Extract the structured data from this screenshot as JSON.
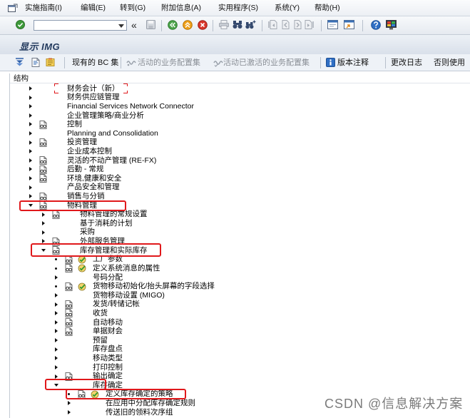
{
  "window": {
    "title": "显示 IMG"
  },
  "menu_bar": {
    "items": [
      "实施指南(I)",
      "编辑(E)",
      "转到(G)",
      "附加信息(A)",
      "实用程序(S)",
      "系统(Y)",
      "帮助(H)"
    ]
  },
  "toolbar": {
    "command_field": {
      "value": "",
      "placeholder": ""
    },
    "collapse_glyph": "«",
    "icons": [
      "enter-icon",
      "save-icon",
      "back-icon",
      "exit-icon",
      "cancel-icon",
      "print-icon",
      "find-icon",
      "find-next-icon",
      "first-page-icon",
      "previous-page-icon",
      "next-page-icon",
      "last-page-icon",
      "create-session-icon",
      "create-shortcut-icon",
      "help-icon",
      "customize-layout-icon"
    ]
  },
  "app_toolbar": {
    "icons": [
      "expand-subtree-icon",
      "documentation-icon",
      "notes-icon",
      "bc-set-icon",
      "bc-set-activated-icon",
      "info-icon"
    ],
    "existing_bc_sets": "现有的 BC 集",
    "active_bc_sets": "活动的业务配置集",
    "activated_bc_sets": "活动已激活的业务配置集",
    "release_notes": "版本注释",
    "change_log": "更改日志",
    "where_used": "否则使用"
  },
  "structure_header": "结构",
  "tree": [
    {
      "label": "财务会计（新）",
      "level": 0,
      "state": "collapsed",
      "icons": [],
      "focused": true
    },
    {
      "label": "财务供应链管理",
      "level": 0,
      "state": "collapsed",
      "icons": []
    },
    {
      "label": "Financial Services Network Connector",
      "level": 0,
      "state": "collapsed",
      "icons": []
    },
    {
      "label": "企业管理策略/商业分析",
      "level": 0,
      "state": "collapsed",
      "icons": []
    },
    {
      "label": "控制",
      "level": 0,
      "state": "collapsed",
      "icons": [
        "documentation"
      ]
    },
    {
      "label": "Planning and Consolidation",
      "level": 0,
      "state": "collapsed",
      "icons": []
    },
    {
      "label": "投资管理",
      "level": 0,
      "state": "collapsed",
      "icons": [
        "documentation"
      ]
    },
    {
      "label": "企业成本控制",
      "level": 0,
      "state": "collapsed",
      "icons": []
    },
    {
      "label": "灵活的不动产管理 (RE-FX)",
      "level": 0,
      "state": "collapsed",
      "icons": [
        "documentation"
      ]
    },
    {
      "label": "后勤 - 常规",
      "level": 0,
      "state": "collapsed",
      "icons": [
        "documentation"
      ]
    },
    {
      "label": "环境,健康和安全",
      "level": 0,
      "state": "collapsed",
      "icons": [
        "documentation"
      ]
    },
    {
      "label": "产品安全和管理",
      "level": 0,
      "state": "collapsed",
      "icons": []
    },
    {
      "label": "销售与分销",
      "level": 0,
      "state": "collapsed",
      "icons": [
        "documentation"
      ]
    },
    {
      "label": "物料管理",
      "level": 0,
      "state": "expanded",
      "icons": [
        "documentation"
      ],
      "highlighted": true
    },
    {
      "label": "物料管理的常规设置",
      "level": 1,
      "state": "collapsed",
      "icons": [
        "documentation"
      ]
    },
    {
      "label": "基于消耗的计划",
      "level": 1,
      "state": "collapsed",
      "icons": []
    },
    {
      "label": "采购",
      "level": 1,
      "state": "collapsed",
      "icons": []
    },
    {
      "label": "外部服务管理",
      "level": 1,
      "state": "collapsed",
      "icons": [
        "documentation"
      ]
    },
    {
      "label": "库存管理和实际库存",
      "level": 1,
      "state": "expanded",
      "icons": [
        "documentation"
      ],
      "highlighted": true
    },
    {
      "label": "工厂参数",
      "level": 2,
      "state": "leaf",
      "icons": [
        "documentation",
        "execute"
      ]
    },
    {
      "label": "定义系统消息的属性",
      "level": 2,
      "state": "leaf",
      "icons": [
        "documentation",
        "execute"
      ]
    },
    {
      "label": "号码分配",
      "level": 2,
      "state": "collapsed",
      "icons": []
    },
    {
      "label": "货物移动初始化/抬头屏幕的字段选择",
      "level": 2,
      "state": "leaf",
      "icons": [
        "documentation",
        "execute"
      ]
    },
    {
      "label": "货物移动设置 (MIGO)",
      "level": 2,
      "state": "collapsed",
      "icons": []
    },
    {
      "label": "发货/转储记帐",
      "level": 2,
      "state": "collapsed",
      "icons": [
        "documentation"
      ]
    },
    {
      "label": "收货",
      "level": 2,
      "state": "collapsed",
      "icons": [
        "documentation"
      ]
    },
    {
      "label": "自动移动",
      "level": 2,
      "state": "collapsed",
      "icons": [
        "documentation"
      ]
    },
    {
      "label": "单据财会",
      "level": 2,
      "state": "collapsed",
      "icons": [
        "documentation"
      ]
    },
    {
      "label": "预留",
      "level": 2,
      "state": "collapsed",
      "icons": []
    },
    {
      "label": "库存盘点",
      "level": 2,
      "state": "collapsed",
      "icons": []
    },
    {
      "label": "移动类型",
      "level": 2,
      "state": "collapsed",
      "icons": []
    },
    {
      "label": "打印控制",
      "level": 2,
      "state": "collapsed",
      "icons": []
    },
    {
      "label": "输出确定",
      "level": 2,
      "state": "collapsed",
      "icons": [
        "documentation"
      ]
    },
    {
      "label": "库存确定",
      "level": 2,
      "state": "expanded",
      "icons": [],
      "highlighted": true
    },
    {
      "label": "定义库存确定的策略",
      "level": 3,
      "state": "leaf",
      "icons": [
        "documentation",
        "execute"
      ],
      "highlighted": true
    },
    {
      "label": "在应用中分配库存确定规则",
      "level": 3,
      "state": "collapsed",
      "icons": []
    },
    {
      "label": "传送旧的领料次序组",
      "level": 3,
      "state": "collapsed",
      "icons": []
    }
  ],
  "watermark": "CSDN @信息解决方案",
  "colors": {
    "highlight": "#e0181b",
    "title_text": "#233a5e",
    "disabled_text": "#8a8f96",
    "enter_green": "#3d9a3a",
    "cancel_red": "#d9362b",
    "exit_orange": "#f0a21b"
  }
}
